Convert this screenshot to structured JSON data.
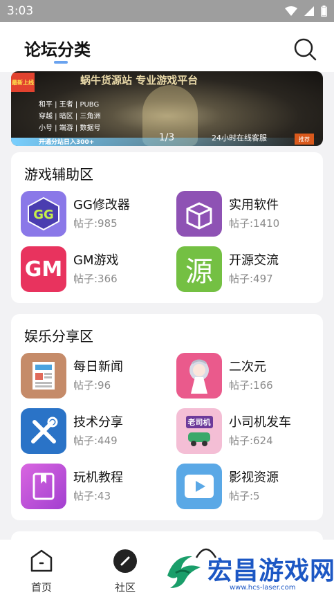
{
  "status_bar": {
    "time": "3:03"
  },
  "header": {
    "title": "论坛分类"
  },
  "banner": {
    "title": "蜗牛货源站 专业游戏平台",
    "tag": "最新上线",
    "subtitle": "和平 | 王者 | PUBG\n穿越 | 暗区 | 三角洲\n小号 | 端游 | 数据号",
    "bottom_text": "开通分站日入300+",
    "right_text": "24小时在线客服",
    "recommend": "推荐",
    "counter": "1/3"
  },
  "sections": [
    {
      "title": "游戏辅助区",
      "items": [
        {
          "name": "GG修改器",
          "count": "帖子:985",
          "icon": "gg-modifier-icon"
        },
        {
          "name": "实用软件",
          "count": "帖子:1410",
          "icon": "box-icon"
        },
        {
          "name": "GM游戏",
          "count": "帖子:366",
          "icon": "gm-icon",
          "icon_text": "GM"
        },
        {
          "name": "开源交流",
          "count": "帖子:497",
          "icon": "source-icon",
          "icon_text": "源"
        }
      ]
    },
    {
      "title": "娱乐分享区",
      "items": [
        {
          "name": "每日新闻",
          "count": "帖子:96",
          "icon": "newspaper-icon"
        },
        {
          "name": "二次元",
          "count": "帖子:166",
          "icon": "anime-girl-icon"
        },
        {
          "name": "技术分享",
          "count": "帖子:449",
          "icon": "tools-icon"
        },
        {
          "name": "小司机发车",
          "count": "帖子:624",
          "icon": "driver-icon",
          "icon_text": "老司机"
        },
        {
          "name": "玩机教程",
          "count": "帖子:43",
          "icon": "book-icon"
        },
        {
          "name": "影视资源",
          "count": "帖子:5",
          "icon": "video-play-icon"
        }
      ]
    }
  ],
  "tabbar": {
    "home": "首页",
    "community": "社区"
  },
  "watermark": {
    "text": "宏昌游戏网",
    "url": "www.hcs-laser.com"
  },
  "colors": {
    "accent": "#6aa3ef",
    "gm": "#e8335e",
    "source": "#74c043",
    "box": "#8e52b4",
    "tools": "#2a73c7",
    "watermark": "#1c57c4"
  }
}
